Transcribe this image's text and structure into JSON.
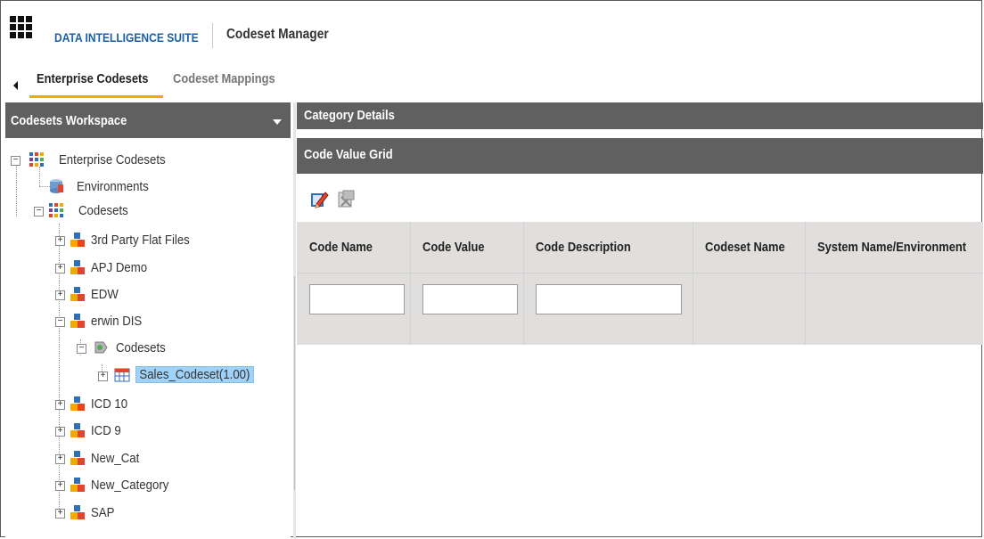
{
  "header": {
    "suite_name": "DATA INTELLIGENCE SUITE",
    "app_title": "Codeset Manager"
  },
  "tabs": [
    {
      "label": "Enterprise Codesets",
      "active": true
    },
    {
      "label": "Codeset Mappings",
      "active": false
    }
  ],
  "workspace": {
    "title": "Codesets Workspace",
    "tree": {
      "root": "Enterprise Codesets",
      "environments": "Environments",
      "codesets": "Codesets",
      "categories": [
        "3rd Party Flat Files",
        "APJ Demo",
        "EDW",
        "erwin DIS",
        "ICD 10",
        "ICD 9",
        "New_Cat",
        "New_Category",
        "SAP"
      ],
      "erwin_codesets_folder": "Codesets",
      "selected_codeset": "Sales_Codeset(1.00)"
    }
  },
  "details": {
    "category_details": "Category Details",
    "code_value_grid": "Code Value Grid"
  },
  "grid": {
    "columns": [
      "Code Name",
      "Code Value",
      "Code Description",
      "Codeset Name",
      "System Name/Environment"
    ],
    "filters": [
      "",
      "",
      ""
    ]
  },
  "icons": {
    "edit": "edit-pencil-icon",
    "delete": "delete-icon",
    "category": "category-folder-icon"
  },
  "colors": {
    "panel_header": "#606060",
    "tab_underline": "#f2a900",
    "suite_name": "#1a5fa8",
    "selection": "#9fd2f6",
    "grid_bg": "#e0dfdd"
  }
}
